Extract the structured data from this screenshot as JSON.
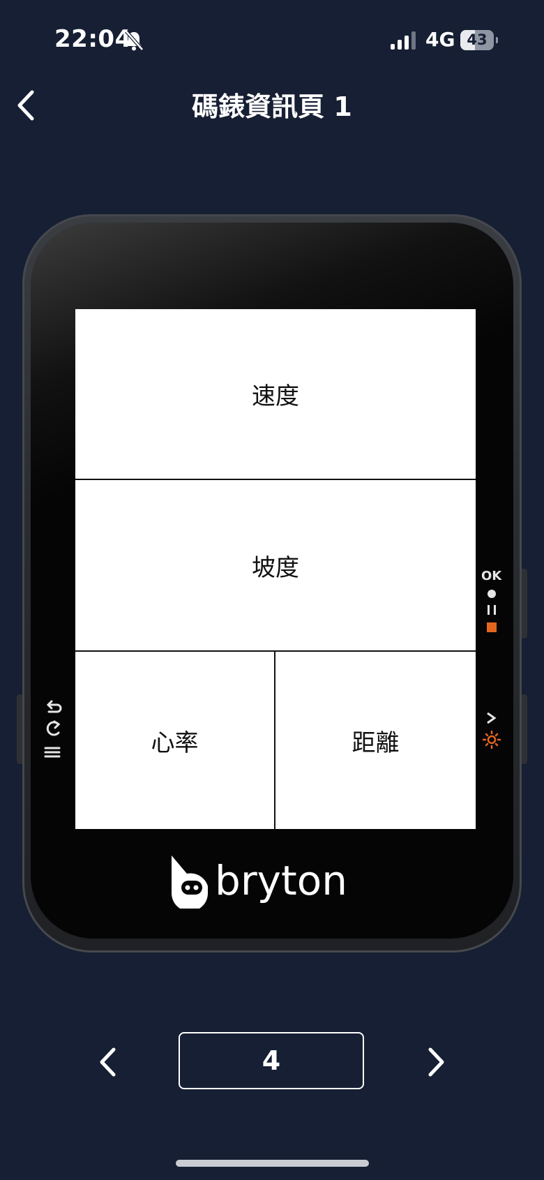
{
  "status_bar": {
    "time": "22:04",
    "network": "4G",
    "battery_percent": 43,
    "battery_text": "43"
  },
  "header": {
    "title": "碼錶資訊頁 1",
    "back_icon": "chevron-left-icon"
  },
  "device": {
    "brand": "bryton",
    "fields": {
      "speed": "速度",
      "grade": "坡度",
      "heart_rate": "心率",
      "distance": "距離"
    },
    "side_labels": {
      "ok": "OK"
    }
  },
  "pager": {
    "value": "4",
    "prev_icon": "chevron-left-icon",
    "next_icon": "chevron-right-icon"
  },
  "colors": {
    "background": "#161f33",
    "accent_orange": "#e3661f",
    "text": "#ffffff"
  }
}
